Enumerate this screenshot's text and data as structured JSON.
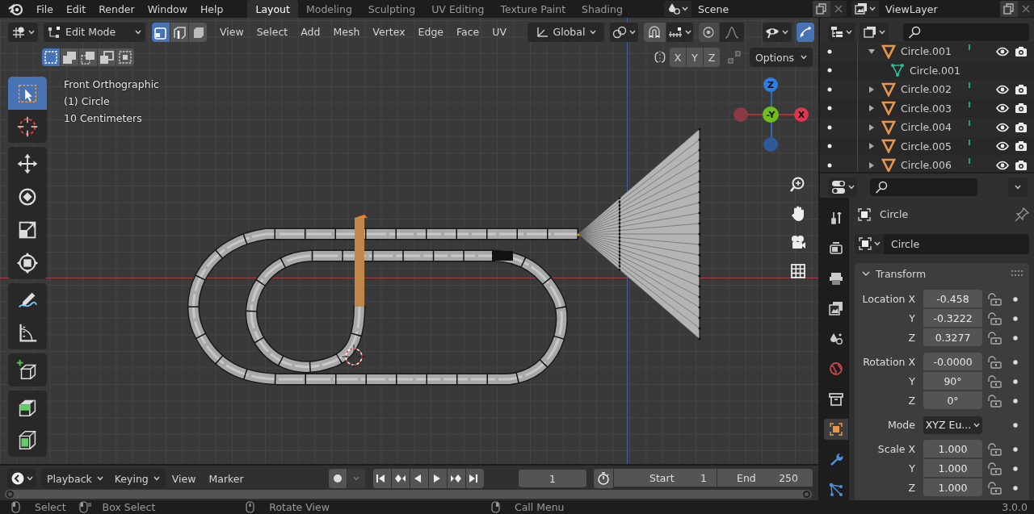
{
  "top_bar": {
    "menus": [
      "File",
      "Edit",
      "Render",
      "Window",
      "Help"
    ],
    "workspaces": [
      {
        "label": "Layout",
        "selected": true
      },
      {
        "label": "Modeling",
        "selected": false
      },
      {
        "label": "Sculpting",
        "selected": false
      },
      {
        "label": "UV Editing",
        "selected": false
      },
      {
        "label": "Texture Paint",
        "selected": false
      },
      {
        "label": "Shading",
        "selected": false
      }
    ],
    "scene": "Scene",
    "view_layer": "ViewLayer"
  },
  "viewport": {
    "mode": "Edit Mode",
    "select_modes": [
      {
        "kind": "vertex",
        "selected": true
      },
      {
        "kind": "edge",
        "selected": false
      },
      {
        "kind": "face",
        "selected": false
      }
    ],
    "menus": [
      "View",
      "Select",
      "Add",
      "Mesh",
      "Vertex",
      "Edge",
      "Face",
      "UV"
    ],
    "orientation": "Global",
    "xray": true,
    "selection_ops": [
      {
        "kind": "set",
        "selected": true
      },
      {
        "kind": "extend",
        "selected": false
      },
      {
        "kind": "subtract",
        "selected": false
      },
      {
        "kind": "invert",
        "selected": false
      },
      {
        "kind": "intersect",
        "selected": false
      }
    ],
    "mirror_axes": [
      {
        "label": "X",
        "selected": false
      },
      {
        "label": "Y",
        "selected": false
      },
      {
        "label": "Z",
        "selected": false
      }
    ],
    "options": "Options",
    "info": [
      "Front Orthographic",
      "(1) Circle",
      "10 Centimeters"
    ],
    "tool_groups": [
      {
        "tools": [
          {
            "kind": "select",
            "selected": true
          },
          {
            "kind": "cursor",
            "selected": false
          }
        ]
      },
      {
        "tools": [
          {
            "kind": "move",
            "selected": false
          },
          {
            "kind": "rotate",
            "selected": false
          },
          {
            "kind": "scale",
            "selected": false
          },
          {
            "kind": "transform",
            "selected": false
          }
        ]
      },
      {
        "tools": [
          {
            "kind": "annotate",
            "selected": false
          },
          {
            "kind": "measure",
            "selected": false
          }
        ]
      },
      {
        "tools": [
          {
            "kind": "add-cube",
            "selected": false
          }
        ]
      },
      {
        "tools": [
          {
            "kind": "extrude",
            "selected": false
          },
          {
            "kind": "inset",
            "selected": false
          }
        ]
      }
    ],
    "gizmo_labels": [
      "Z",
      "-Y",
      "X"
    ]
  },
  "outliner": {
    "rows": [
      {
        "name": "Circle.001",
        "kind": "object",
        "expanded": true,
        "children": [
          {
            "name": "Circle.001",
            "kind": "mesh"
          }
        ]
      },
      {
        "name": "Circle.002",
        "kind": "object",
        "expanded": false
      },
      {
        "name": "Circle.003",
        "kind": "object",
        "expanded": false
      },
      {
        "name": "Circle.004",
        "kind": "object",
        "expanded": false
      },
      {
        "name": "Circle.005",
        "kind": "object",
        "expanded": false
      },
      {
        "name": "Circle.006",
        "kind": "object",
        "expanded": false
      }
    ]
  },
  "properties": {
    "tabs": [
      {
        "kind": "tool",
        "selected": false
      },
      {
        "kind": "render",
        "selected": false
      },
      {
        "kind": "output",
        "selected": false
      },
      {
        "kind": "view-layer",
        "selected": false
      },
      {
        "kind": "scene",
        "selected": false
      },
      {
        "kind": "world",
        "selected": false
      },
      {
        "kind": "collection",
        "selected": false
      },
      {
        "kind": "object",
        "selected": true
      },
      {
        "kind": "modifier",
        "selected": false
      },
      {
        "kind": "particles",
        "selected": false
      }
    ],
    "object_name": "Circle",
    "datablock": "Circle",
    "panel": {
      "title": "Transform",
      "expanded": true,
      "groups": [
        {
          "rows": [
            {
              "kind": "number",
              "label": "Location X",
              "value": "-0.458"
            },
            {
              "kind": "number",
              "label": "Y",
              "value": "-0.3222"
            },
            {
              "kind": "number",
              "label": "Z",
              "value": "0.3277"
            }
          ]
        },
        {
          "rows": [
            {
              "kind": "number",
              "label": "Rotation X",
              "value": "-0.0000"
            },
            {
              "kind": "number",
              "label": "Y",
              "value": "90°"
            },
            {
              "kind": "number",
              "label": "Z",
              "value": "0°"
            }
          ]
        },
        {
          "rows": [
            {
              "kind": "dropdown",
              "label": "Mode",
              "value": "XYZ Eu..."
            }
          ]
        },
        {
          "rows": [
            {
              "kind": "number",
              "label": "Scale X",
              "value": "1.000"
            },
            {
              "kind": "number",
              "label": "Y",
              "value": "1.000"
            },
            {
              "kind": "number",
              "label": "Z",
              "value": "1.000"
            }
          ]
        }
      ]
    }
  },
  "timeline": {
    "menus": [
      {
        "label": "Playback",
        "dropdown": true
      },
      {
        "label": "Keying",
        "dropdown": true
      },
      {
        "label": "View",
        "dropdown": false
      },
      {
        "label": "Marker",
        "dropdown": false
      }
    ],
    "current_frame": "1",
    "start_label": "Start",
    "start": "1",
    "end_label": "End",
    "end": "250"
  },
  "status_bar": {
    "hints": [
      {
        "kind": "left-click",
        "label": "Select"
      },
      {
        "kind": "left-drag",
        "label": "Box Select"
      },
      {
        "kind": "middle-click",
        "label": "Rotate View"
      },
      {
        "kind": "right-click",
        "label": "Call Menu"
      }
    ],
    "version": "3.0.0"
  }
}
